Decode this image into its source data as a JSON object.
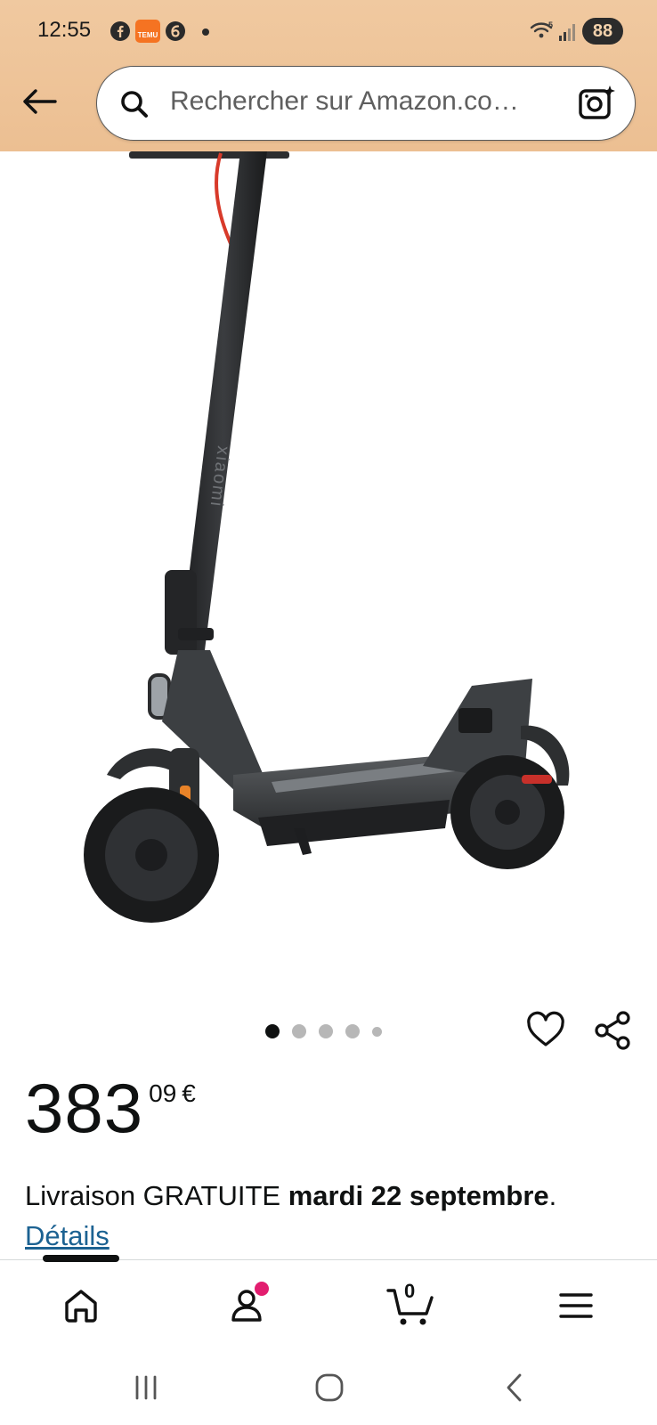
{
  "status_bar": {
    "time": "12:55",
    "temu_label": "TEMU",
    "battery": "88"
  },
  "search": {
    "placeholder": "Rechercher sur Amazon.co…"
  },
  "product": {
    "brand_on_image": "xiaomi",
    "carousel": {
      "total": 5,
      "active_index": 0
    }
  },
  "price": {
    "whole": "383",
    "fraction": "09",
    "currency": "€"
  },
  "delivery": {
    "prefix": "Livraison GRATUITE ",
    "date": "mardi 22 septembre",
    "suffix": ".",
    "details_link": "Détails"
  },
  "bottom_nav": {
    "items": [
      {
        "name": "home",
        "icon": "home-icon"
      },
      {
        "name": "account",
        "icon": "user-icon"
      },
      {
        "name": "cart",
        "icon": "cart-icon",
        "count": "0"
      },
      {
        "name": "menu",
        "icon": "menu-icon"
      }
    ]
  },
  "colors": {
    "header_bg": "#ecbf92",
    "link": "#1c6292",
    "badge": "#e21d6f"
  }
}
